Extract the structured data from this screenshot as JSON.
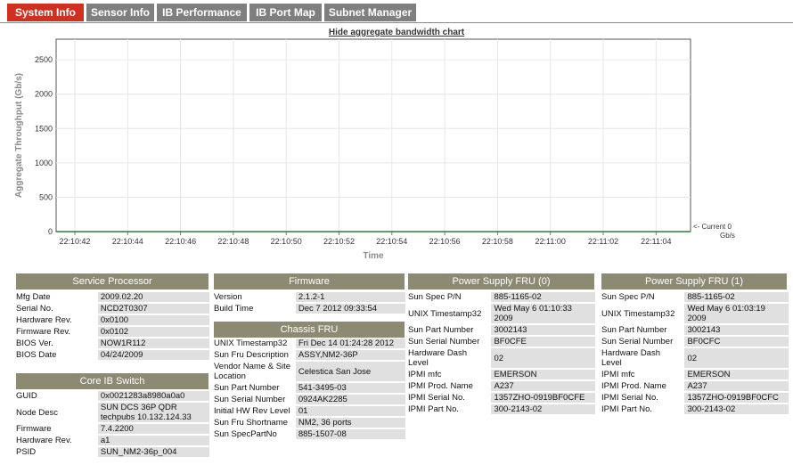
{
  "tabs": [
    {
      "label": "System Info",
      "active": true
    },
    {
      "label": "Sensor Info",
      "active": false
    },
    {
      "label": "IB Performance",
      "active": false
    },
    {
      "label": "IB Port Map",
      "active": false
    },
    {
      "label": "Subnet Manager",
      "active": false
    }
  ],
  "colors": {
    "active_tab": "#d0301f",
    "inactive_tab": "#7f7f7f",
    "section_header": "#8c8a72",
    "value_bg": "#e0e0e0",
    "series": "#2e7d32"
  },
  "hide_chart_link": "Hide aggregate bandwidth chart",
  "chart_data": {
    "type": "line",
    "ylabel": "Aggregate Throughput (Gb/s)",
    "xlabel": "Time",
    "ylim": [
      0,
      2800
    ],
    "yticks": [
      0,
      500,
      1000,
      1500,
      2000,
      2500
    ],
    "categories": [
      "22:10:42",
      "22:10:44",
      "22:10:46",
      "22:10:48",
      "22:10:50",
      "22:10:52",
      "22:10:54",
      "22:10:56",
      "22:10:58",
      "22:11:00",
      "22:11:02",
      "22:11:04"
    ],
    "series": [
      {
        "values": [
          0,
          0,
          0,
          0,
          0,
          0,
          0,
          0,
          0,
          0,
          0,
          0
        ]
      }
    ],
    "current_label": "<- Current 0",
    "current_unit": "Gb/s",
    "grid": true
  },
  "service_processor": {
    "title": "Service Processor",
    "rows": [
      {
        "k": "Mfg Date",
        "v": "2009.02.20"
      },
      {
        "k": "Serial No.",
        "v": "NCD2T0307"
      },
      {
        "k": "Hardware Rev.",
        "v": "0x0100"
      },
      {
        "k": "Firmware Rev.",
        "v": "0x0102"
      },
      {
        "k": "BIOS Ver.",
        "v": "NOW1R112"
      },
      {
        "k": "BIOS Date",
        "v": "04/24/2009"
      }
    ]
  },
  "core_ib_switch": {
    "title": "Core IB Switch",
    "rows": [
      {
        "k": "GUID",
        "v": "0x0021283a8980a0a0"
      },
      {
        "k": "Node Desc",
        "v": "SUN DCS 36P QDR techpubs 10.132.124.33"
      },
      {
        "k": "Firmware",
        "v": "7.4.2200"
      },
      {
        "k": "Hardware Rev.",
        "v": "a1"
      },
      {
        "k": "PSID",
        "v": "SUN_NM2-36p_004"
      }
    ]
  },
  "firmware": {
    "title": "Firmware",
    "rows": [
      {
        "k": "Version",
        "v": "2.1.2-1"
      },
      {
        "k": "Build Time",
        "v": "Dec 7 2012 09:33:54"
      }
    ]
  },
  "chassis_fru": {
    "title": "Chassis FRU",
    "rows": [
      {
        "k": "UNIX Timestamp32",
        "v": "Fri Dec 14 01:24:28 2012"
      },
      {
        "k": "Sun Fru Description",
        "v": "ASSY,NM2-36P"
      },
      {
        "k": "Vendor Name & Site Location",
        "v": "Celestica San Jose"
      },
      {
        "k": "Sun Part Number",
        "v": "541-3495-03"
      },
      {
        "k": "Sun Serial Number",
        "v": "0924AK2285"
      },
      {
        "k": "Initial HW Rev Level",
        "v": "01"
      },
      {
        "k": "Sun Fru Shortname",
        "v": "NM2, 36 ports"
      },
      {
        "k": "Sun SpecPartNo",
        "v": "885-1507-08"
      }
    ]
  },
  "psu0": {
    "title": "Power Supply FRU (0)",
    "rows": [
      {
        "k": "Sun Spec P/N",
        "v": "885-1165-02"
      },
      {
        "k": "UNIX Timestamp32",
        "v": "Wed May 6 01:10:33 2009"
      },
      {
        "k": "Sun Part Number",
        "v": "3002143"
      },
      {
        "k": "Sun Serial Number",
        "v": "BF0CFE"
      },
      {
        "k": "Hardware Dash Level",
        "v": "02"
      },
      {
        "k": "IPMI mfc",
        "v": "EMERSON"
      },
      {
        "k": "IPMI Prod. Name",
        "v": "A237"
      },
      {
        "k": "IPMI Serial No.",
        "v": "1357ZHO-0919BF0CFE"
      },
      {
        "k": "IPMI Part No.",
        "v": "300-2143-02"
      }
    ]
  },
  "psu1": {
    "title": "Power Supply FRU (1)",
    "rows": [
      {
        "k": "Sun Spec P/N",
        "v": "885-1165-02"
      },
      {
        "k": "UNIX Timestamp32",
        "v": "Wed May 6 01:03:19 2009"
      },
      {
        "k": "Sun Part Number",
        "v": "3002143"
      },
      {
        "k": "Sun Serial Number",
        "v": "BF0CFC"
      },
      {
        "k": "Hardware Dash Level",
        "v": "02"
      },
      {
        "k": "IPMI mfc",
        "v": "EMERSON"
      },
      {
        "k": "IPMI Prod. Name",
        "v": "A237"
      },
      {
        "k": "IPMI Serial No.",
        "v": "1357ZHO-0919BF0CFC"
      },
      {
        "k": "IPMI Part No.",
        "v": "300-2143-02"
      }
    ]
  }
}
